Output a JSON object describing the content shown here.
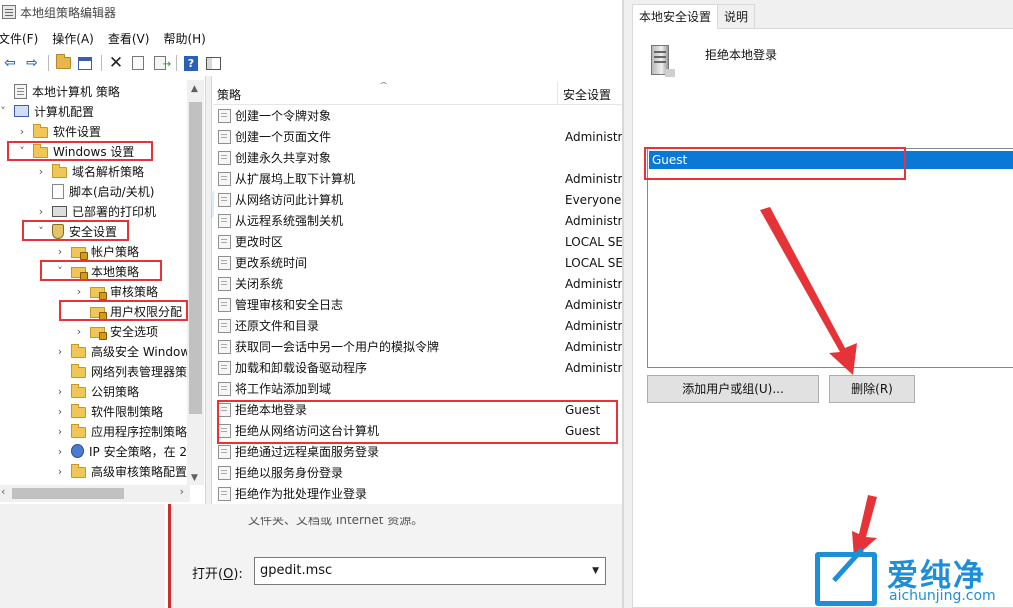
{
  "window": {
    "title": "本地组策略编辑器"
  },
  "menu": [
    "文件(F)",
    "操作(A)",
    "查看(V)",
    "帮助(H)"
  ],
  "toolbar": {
    "icons": [
      "back-arrow-icon",
      "forward-arrow-icon",
      "up-folder-icon",
      "show-tree-icon",
      "delete-icon",
      "properties-icon",
      "export-icon",
      "help-icon",
      "console-tree-icon"
    ]
  },
  "tree": {
    "nodes": [
      {
        "label": "本地计算机 策略",
        "icon": "policy-icon",
        "expander": ""
      },
      {
        "label": "计算机配置",
        "icon": "computer-icon",
        "expander": "˅"
      },
      {
        "label": "软件设置",
        "icon": "folder-icon",
        "expander": "›"
      },
      {
        "label": "Windows 设置",
        "icon": "folder-icon",
        "expander": "˅"
      },
      {
        "label": "域名解析策略",
        "icon": "folder-icon",
        "expander": "›"
      },
      {
        "label": "脚本(启动/关机)",
        "icon": "script-icon",
        "expander": ""
      },
      {
        "label": "已部署的打印机",
        "icon": "printer-icon",
        "expander": "›"
      },
      {
        "label": "安全设置",
        "icon": "shield-icon",
        "expander": "˅"
      },
      {
        "label": "帐户策略",
        "icon": "lock-folder-icon",
        "expander": "›"
      },
      {
        "label": "本地策略",
        "icon": "lock-folder-icon",
        "expander": "˅"
      },
      {
        "label": "审核策略",
        "icon": "lock-folder-icon",
        "expander": "›"
      },
      {
        "label": "用户权限分配",
        "icon": "lock-folder-icon",
        "expander": ""
      },
      {
        "label": "安全选项",
        "icon": "lock-folder-icon",
        "expander": "›"
      },
      {
        "label": "高级安全 Window",
        "icon": "folder-icon",
        "expander": "›"
      },
      {
        "label": "网络列表管理器策",
        "icon": "folder-icon",
        "expander": ""
      },
      {
        "label": "公钥策略",
        "icon": "folder-icon",
        "expander": "›"
      },
      {
        "label": "软件限制策略",
        "icon": "folder-icon",
        "expander": "›"
      },
      {
        "label": "应用程序控制策略",
        "icon": "folder-icon",
        "expander": "›"
      },
      {
        "label": "IP 安全策略，在 2",
        "icon": "ipsec-icon",
        "expander": "›"
      },
      {
        "label": "高级审核策略配置",
        "icon": "folder-icon",
        "expander": "›"
      }
    ]
  },
  "list": {
    "columns": [
      "策略",
      "安全设置"
    ],
    "rows": [
      {
        "name": "创建一个令牌对象",
        "value": ""
      },
      {
        "name": "创建一个页面文件",
        "value": "Administr"
      },
      {
        "name": "创建永久共享对象",
        "value": ""
      },
      {
        "name": "从扩展坞上取下计算机",
        "value": "Administr"
      },
      {
        "name": "从网络访问此计算机",
        "value": "Everyone,"
      },
      {
        "name": "从远程系统强制关机",
        "value": "Administr"
      },
      {
        "name": "更改时区",
        "value": "LOCAL SE"
      },
      {
        "name": "更改系统时间",
        "value": "LOCAL SE"
      },
      {
        "name": "关闭系统",
        "value": "Administr"
      },
      {
        "name": "管理审核和安全日志",
        "value": "Administr"
      },
      {
        "name": "还原文件和目录",
        "value": "Administr"
      },
      {
        "name": "获取同一会话中另一个用户的模拟令牌",
        "value": "Administr"
      },
      {
        "name": "加载和卸载设备驱动程序",
        "value": "Administr"
      },
      {
        "name": "将工作站添加到域",
        "value": ""
      },
      {
        "name": "拒绝本地登录",
        "value": "Guest"
      },
      {
        "name": "拒绝从网络访问这台计算机",
        "value": "Guest"
      },
      {
        "name": "拒绝通过远程桌面服务登录",
        "value": ""
      },
      {
        "name": "拒绝以服务身份登录",
        "value": ""
      },
      {
        "name": "拒绝作为批处理作业登录",
        "value": ""
      }
    ]
  },
  "run_dialog": {
    "partial_text": "文件夹、文档或 Internet 资源。",
    "open_label": "打开(",
    "open_label_key": "O",
    "open_label_end": "):",
    "command_value": "gpedit.msc"
  },
  "properties": {
    "tabs": [
      "本地安全设置",
      "说明"
    ],
    "policy_name": "拒绝本地登录",
    "users": [
      "Guest"
    ],
    "add_button": "添加用户或组(U)...",
    "remove_button": "删除(R)"
  },
  "watermark": {
    "brand": "爱纯净",
    "url": "aichunjing.com"
  },
  "colors": {
    "highlight": "#e53338",
    "selection": "#0a79d6",
    "brand": "#1f8ed8"
  }
}
